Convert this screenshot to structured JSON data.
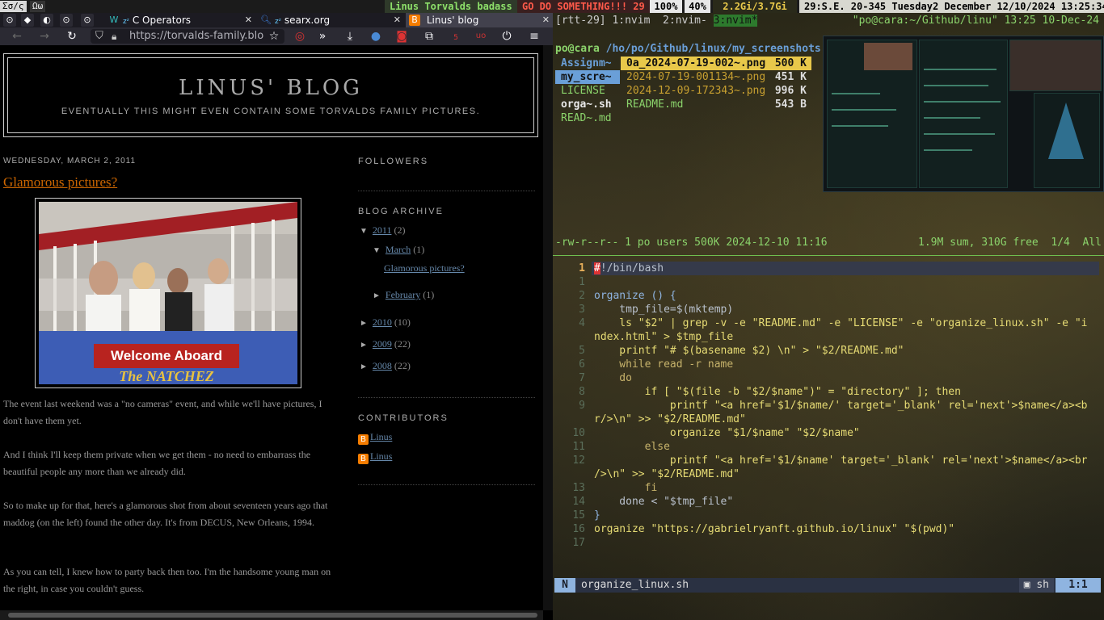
{
  "topbar": {
    "workspace1": "Σσ/ς",
    "workspace2": "Ωω",
    "title_text": "Linus Torvalds badass",
    "alert_text": "GO DO SOMETHING!!! 29",
    "vol": "100%",
    "bright": "40%",
    "mem": "2.2Gi/3.7Gi",
    "datetime": "29:S.E. 20-345 Tuesday2 December 12/10/2024 13:25:34"
  },
  "browser": {
    "tabs": [
      {
        "label": "C Operators"
      },
      {
        "label": "searx.org"
      },
      {
        "label": "Linus' blog"
      }
    ],
    "url": "https://torvalds-family.blo",
    "badge": "5"
  },
  "blog": {
    "title": "LINUS' BLOG",
    "description": "EVENTUALLY THIS MIGHT EVEN CONTAIN SOME TORVALDS FAMILY PICTURES.",
    "post_date": "WEDNESDAY, MARCH 2, 2011",
    "post_title": "Glamorous pictures?",
    "photo_sign_1": "Welcome Aboard",
    "photo_sign_2": "The NATCHEZ",
    "paragraphs": [
      "The event last weekend was a \"no cameras\" event, and while we'll have pictures, I don't have them yet.",
      "And I think I'll keep them private when we get them - no need to embarrass the beautiful people any more than we already did.",
      "So to make up for that, here's a glamorous shot from about seventeen years ago that maddog (on the left) found the other day. It's from DECUS, New Orleans, 1994.",
      "As you can tell, I knew how to party back then too. I'm the handsome young man on the right, in case you couldn't guess."
    ],
    "sidebar": {
      "followers_heading": "FOLLOWERS",
      "archive_heading": "BLOG ARCHIVE",
      "archive": [
        {
          "label": "2011",
          "count": "(2)",
          "tri": "▼"
        },
        {
          "label": "March",
          "count": "(1)",
          "tri": "▼"
        },
        {
          "label": "Glamorous pictures?"
        },
        {
          "label": "February",
          "count": "(1)",
          "tri": "►"
        },
        {
          "label": "2010",
          "count": "(10)",
          "tri": "►"
        },
        {
          "label": "2009",
          "count": "(22)",
          "tri": "►"
        },
        {
          "label": "2008",
          "count": "(22)",
          "tri": "►"
        }
      ],
      "contributors_heading": "CONTRIBUTORS",
      "contributors": [
        "Linus",
        "Linus"
      ]
    }
  },
  "terminal": {
    "tmux_left_1": "[rtt-29] 1:nvim  2:nvim- ",
    "tmux_left_sel": "3:nvim*",
    "tmux_right": "\"po@cara:~/Github/linu\" 13:25 10-Dec-24",
    "ranger_path_user": "po@cara",
    "ranger_path": " /ho/po/Github/linux/my_screenshots",
    "ranger_left": [
      "Assignm~",
      "my_scre~",
      "LICENSE",
      "orga~.sh",
      "READ~.md"
    ],
    "ranger_files": [
      {
        "name": "0a_2024-07-19-002~.png",
        "size": "500 K"
      },
      {
        "name": "2024-07-19-001134~.png",
        "size": "451 K"
      },
      {
        "name": "2024-12-09-172343~.png",
        "size": "996 K"
      },
      {
        "name": "README.md",
        "size": "543 B"
      }
    ],
    "ranger_status_left": "-rw-r--r-- 1 po users 500K 2024-12-10 11:16",
    "ranger_status_right": "1.9M sum, 310G free  1/4  All",
    "code_lines": [
      {
        "n": "1"
      },
      {
        "n": "1"
      },
      {
        "n": "2"
      },
      {
        "n": "3"
      },
      {
        "n": "4"
      },
      {
        "n": ""
      },
      {
        "n": "5"
      },
      {
        "n": "6"
      },
      {
        "n": "7"
      },
      {
        "n": "8"
      },
      {
        "n": "9"
      },
      {
        "n": ""
      },
      {
        "n": "10"
      },
      {
        "n": "11"
      },
      {
        "n": "12"
      },
      {
        "n": ""
      },
      {
        "n": "13"
      },
      {
        "n": "14"
      },
      {
        "n": "15"
      },
      {
        "n": "16"
      },
      {
        "n": "17"
      }
    ],
    "code": {
      "l1": "!/bin/bash",
      "l1_cursor": "#",
      "l3": "organize () {",
      "l4": "    tmp_file=$(mktemp)",
      "l5a": "    ls \"$2\" | grep -v -e \"README.md\" -e \"LICENSE\" -e \"organize_linux.sh\" -e \"i",
      "l5b": "ndex.html\" > $tmp_file",
      "l6": "    printf \"# $(basename $2) \\n\" > \"$2/README.md\"",
      "l7": "    while read -r name",
      "l8": "    do",
      "l9": "        if [ \"$(file -b \"$2/$name\")\" = \"directory\" ]; then",
      "l10a": "            printf \"<a href='$1/$name/' target='_blank' rel='next'>$name</a><b",
      "l10b": "r/>\\n\" >> \"$2/README.md\"",
      "l11": "            organize \"$1/$name\" \"$2/$name\"",
      "l12": "        else",
      "l13a": "            printf \"<a href='$1/$name' target='_blank' rel='next'>$name</a><br",
      "l13b": "/>\\n\" >> \"$2/README.md\"",
      "l14": "        fi",
      "l15": "    done < \"$tmp_file\"",
      "l16": "}",
      "l17": "organize \"https://gabrielryanft.github.io/linux\" \"$(pwd)\""
    },
    "status": {
      "mode": "N",
      "filename": "organize_linux.sh",
      "filetype": "sh",
      "position": "1:1"
    }
  }
}
